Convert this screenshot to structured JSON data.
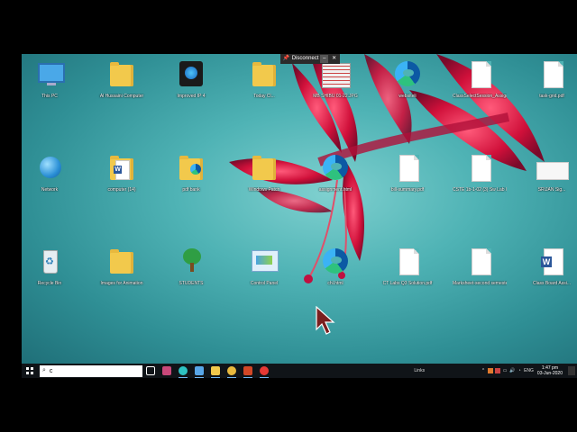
{
  "remote_desktop_bar": {
    "label": "Disconnect"
  },
  "desktop": {
    "icons": [
      {
        "label": "This PC",
        "icon": "this-pc-icon"
      },
      {
        "label": "Al Hussaini Computer",
        "icon": "folder-icon"
      },
      {
        "label": "Improved IP 4",
        "icon": "setup-icon"
      },
      {
        "label": "Today Cl...",
        "icon": "folder-icon"
      },
      {
        "label": "MB SHIBU 01-22.JPG",
        "icon": "photo-icon"
      },
      {
        "label": "websiteli",
        "icon": "edge-icon"
      },
      {
        "label": "ClassSelectSession_Assignment.pdf",
        "icon": "document-icon"
      },
      {
        "label": "task-grid.pdf",
        "icon": "document-icon"
      },
      {
        "label": "Network",
        "icon": "network-icon"
      },
      {
        "label": "computer (14)",
        "icon": "word-folder-icon"
      },
      {
        "label": "pdf bank",
        "icon": "folder-edge-icon"
      },
      {
        "label": "Windows Patch",
        "icon": "folder-icon"
      },
      {
        "label": "assignment.html",
        "icon": "edge-icon"
      },
      {
        "label": "bill-summary.pdf",
        "icon": "document-icon"
      },
      {
        "label": "CSTE 1b-1-02 (3) Sw Lab 02 CHAPT.pdf",
        "icon": "document-icon"
      },
      {
        "label": "SRIJAN Sig...",
        "icon": "sway-icon"
      },
      {
        "label": "Recycle Bin",
        "icon": "recycle-bin-icon"
      },
      {
        "label": "Images for Animation",
        "icon": "folder-icon"
      },
      {
        "label": "STUDENTS",
        "icon": "tree-icon"
      },
      {
        "label": "Control Panel",
        "icon": "control-panel-icon"
      },
      {
        "label": "chl.html",
        "icon": "edge-icon"
      },
      {
        "label": "CT Labs Q3 Solution.pdf",
        "icon": "document-icon"
      },
      {
        "label": "Marksheet-second semester.pdf",
        "icon": "document-icon"
      },
      {
        "label": "Class Board Assi...",
        "icon": "word-icon"
      }
    ]
  },
  "taskbar": {
    "search_value": "c",
    "apps": [
      {
        "name": "task-view-icon",
        "color": "#ffffff"
      },
      {
        "name": "photos-app-icon",
        "color": "#c9487a"
      },
      {
        "name": "edge-app-icon",
        "color": "#2ec2c2"
      },
      {
        "name": "file-manager-icon",
        "color": "#58a6e8"
      },
      {
        "name": "file-explorer-icon",
        "color": "#f2c94c"
      },
      {
        "name": "chrome-icon",
        "color": "#e8b93e"
      },
      {
        "name": "powerpoint-icon",
        "color": "#d24726"
      },
      {
        "name": "recorder-icon",
        "color": "#e53935"
      }
    ],
    "links_label": "Links",
    "tray_language": "ENG",
    "clock_time": "1:47 pm",
    "clock_date": "03-Jun-2020"
  },
  "colors": {
    "taskbar_bg": "#101418",
    "accent": "#6fb6f2"
  }
}
